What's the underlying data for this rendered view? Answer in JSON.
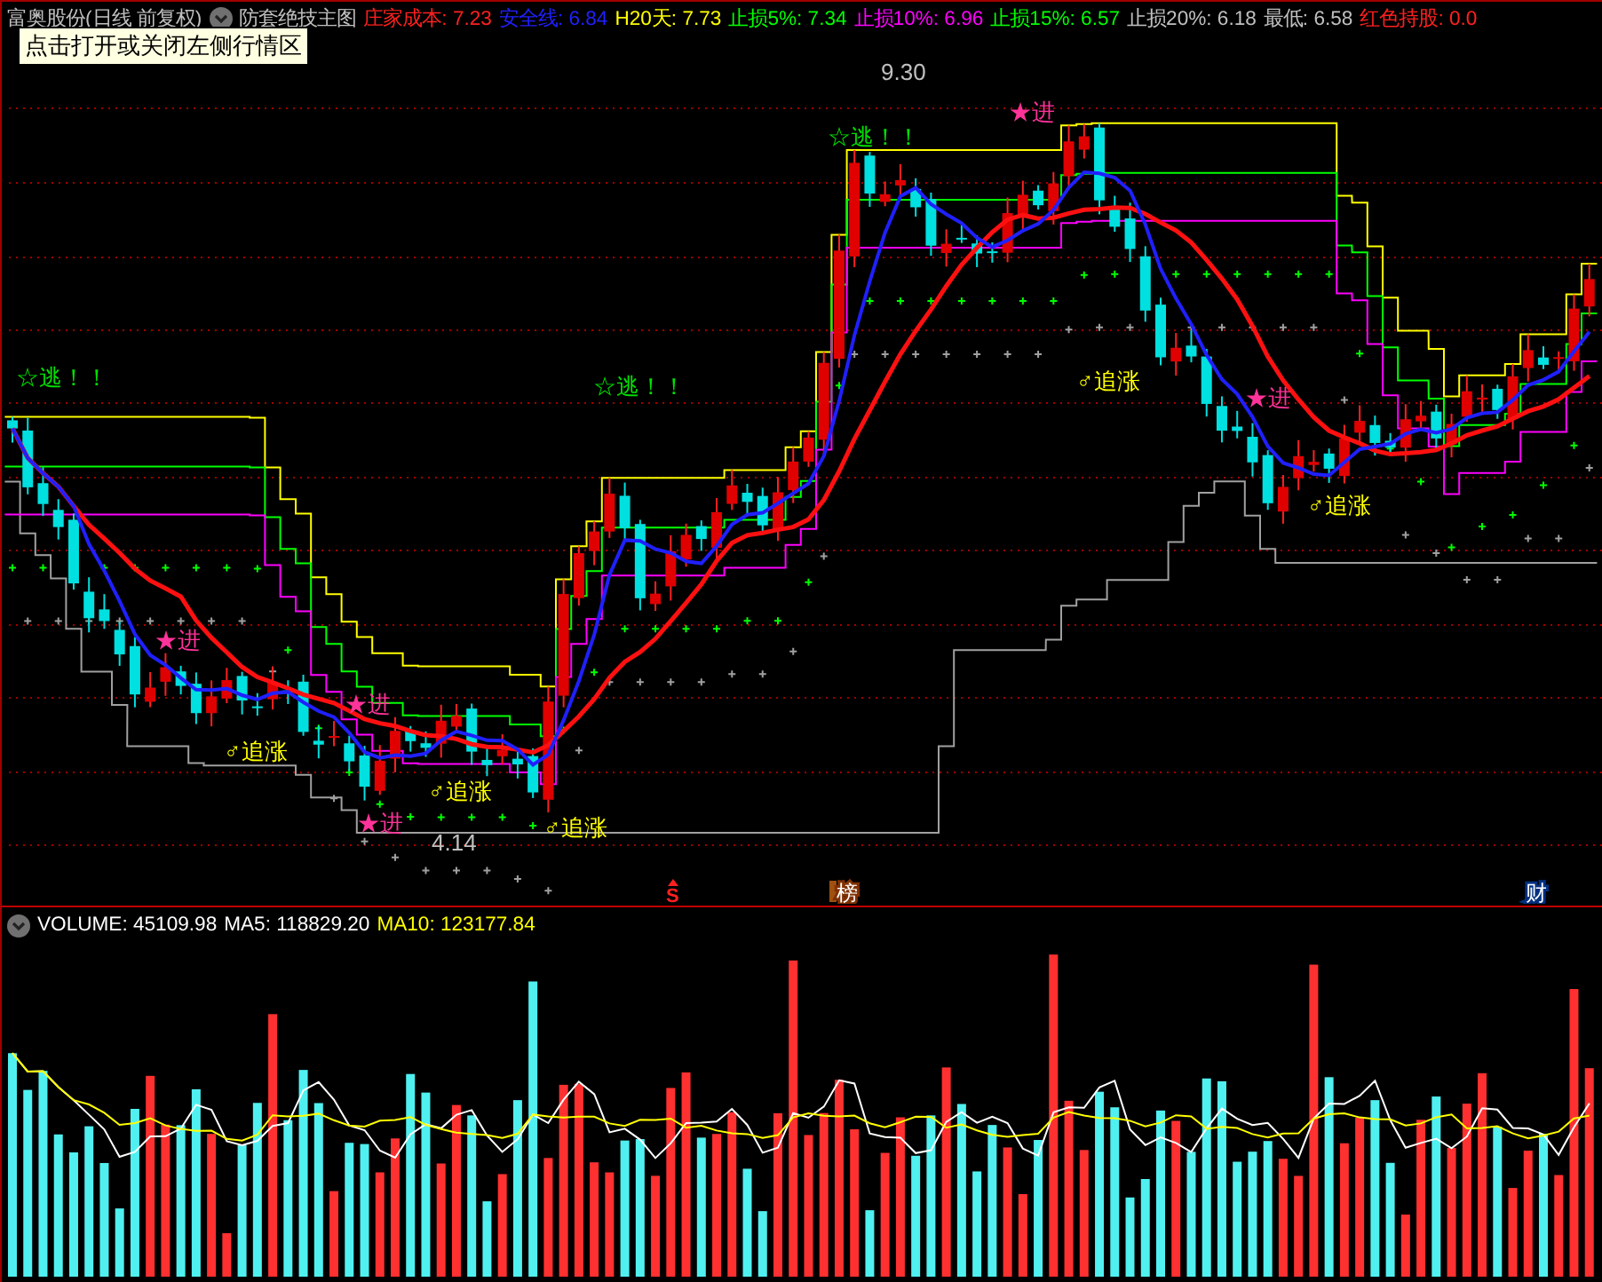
{
  "header": {
    "title": "富奥股份(日线 前复权)",
    "indicator": "防套绝技主图",
    "values": [
      {
        "text": "庄家成本: 7.23",
        "color": "#ff2020"
      },
      {
        "text": "安全线: 6.84",
        "color": "#2020ff"
      },
      {
        "text": "H20天: 7.73",
        "color": "#ffff00"
      },
      {
        "text": "止损5%: 7.34",
        "color": "#00ff00"
      },
      {
        "text": "止损10%: 6.96",
        "color": "#ff00ff"
      },
      {
        "text": "止损15%: 6.57",
        "color": "#00ff00"
      },
      {
        "text": "止损20%: 6.18",
        "color": "#c0c0c0"
      },
      {
        "text": "最低: 6.58",
        "color": "#c0c0c0"
      },
      {
        "text": "红色持股: 0.0",
        "color": "#ff2020"
      }
    ]
  },
  "tooltip": "点击打开或关闭左侧行情区",
  "annotations": [
    {
      "kind": "escape",
      "text": "☆逃！！"
    },
    {
      "kind": "escape",
      "text": "☆逃！！"
    },
    {
      "kind": "escape",
      "text": "☆逃！！"
    },
    {
      "kind": "enter",
      "text": "★进"
    },
    {
      "kind": "enter",
      "text": "★进"
    },
    {
      "kind": "enter",
      "text": "★进"
    },
    {
      "kind": "enter",
      "text": "★进"
    },
    {
      "kind": "enter",
      "text": "★进"
    },
    {
      "kind": "chase",
      "text": "♂追涨"
    },
    {
      "kind": "chase",
      "text": "♂追涨"
    },
    {
      "kind": "chase",
      "text": "♂追涨"
    },
    {
      "kind": "chase",
      "text": "♂追涨"
    },
    {
      "kind": "chase",
      "text": "♂追涨"
    },
    {
      "kind": "price",
      "text": "4.14"
    },
    {
      "kind": "price",
      "text": "9.30"
    }
  ],
  "event_markers": [
    {
      "kind": "flag",
      "text": "S"
    },
    {
      "kind": "rank",
      "text": "榜"
    },
    {
      "kind": "finance",
      "text": "财"
    }
  ],
  "volume": {
    "values": [
      {
        "text": "VOLUME: 45109.98",
        "color": "#ffffff"
      },
      {
        "text": "MA5: 118829.20",
        "color": "#ffffff"
      },
      {
        "text": "MA10: 123177.84",
        "color": "#ffff00"
      }
    ]
  }
}
